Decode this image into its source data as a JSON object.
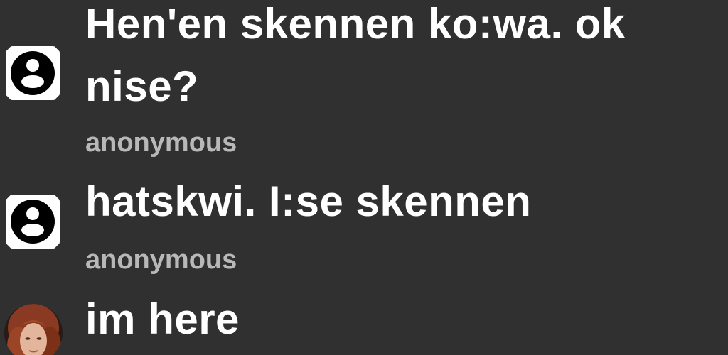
{
  "messages": [
    {
      "lines": [
        "Hen'en skennen ko:wa. ok",
        "nise?"
      ],
      "avatar": "default-person-icon",
      "author": "anonymous"
    },
    {
      "lines": [
        "hatskwi. I:se skennen"
      ],
      "avatar": "default-person-icon",
      "author": "anonymous"
    },
    {
      "lines": [
        "im here"
      ],
      "avatar": "user-photo"
    }
  ],
  "colors": {
    "background": "#303030",
    "message_text": "#ffffff",
    "author_text": "#b8b8b8",
    "avatar_bg": "#ffffff",
    "avatar_icon": "#000000"
  }
}
